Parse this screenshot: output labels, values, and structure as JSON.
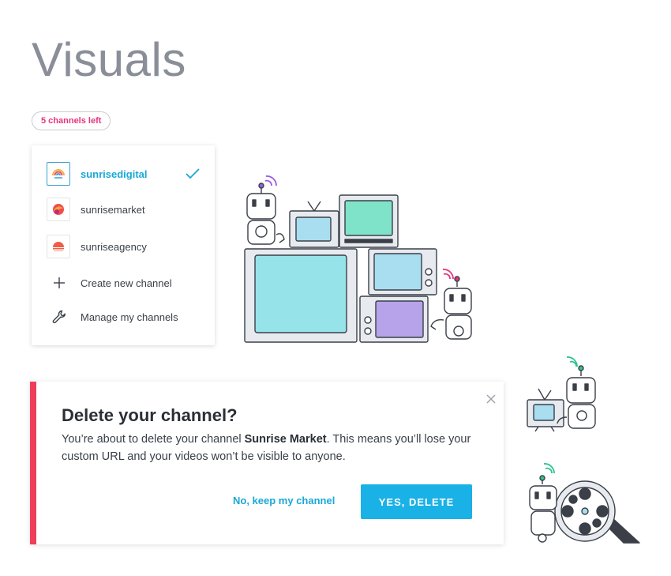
{
  "page": {
    "title": "Visuals"
  },
  "channels_badge": "5 channels left",
  "channel_menu": {
    "items": [
      {
        "label": "sunrisedigital",
        "icon": "sunrisedigital-logo",
        "active": true
      },
      {
        "label": "sunrisemarket",
        "icon": "sunrisemarket-logo",
        "active": false
      },
      {
        "label": "sunriseagency",
        "icon": "sunriseagency-logo",
        "active": false
      },
      {
        "label": "Create new channel",
        "icon": "plus-icon"
      },
      {
        "label": "Manage my channels",
        "icon": "wrench-icon"
      }
    ],
    "check_icon": "check-icon"
  },
  "dialog": {
    "title": "Delete your channel?",
    "body_pre": "You’re about to delete your channel ",
    "body_channel": "Sunrise Market",
    "body_post": ". This means you’ll lose your custom URL and your videos won’t be visible to anyone.",
    "keep_label": "No, keep my channel",
    "delete_label": "YES, DELETE",
    "accent_color": "#ef3e5a",
    "button_color": "#1ab1e6"
  },
  "colors": {
    "title_gray": "#8a8e98",
    "link_blue": "#1aa8d6",
    "badge_pink": "#e6357f"
  }
}
